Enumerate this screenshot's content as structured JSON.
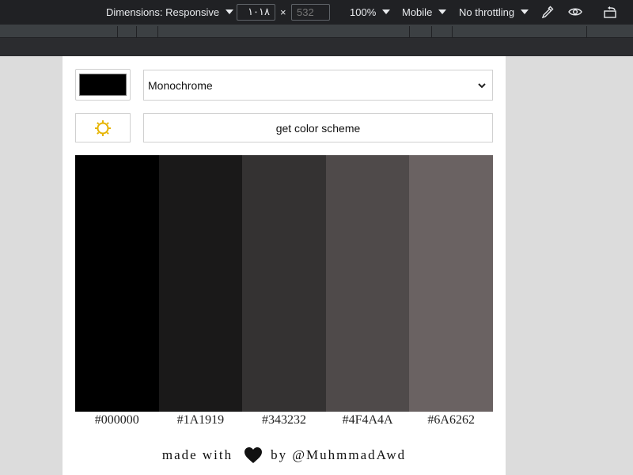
{
  "devtools": {
    "dimensions_label": "Dimensions: Responsive",
    "width_value": "١٠١٨",
    "height_placeholder": "532",
    "times": "×",
    "zoom": "100%",
    "device_type": "Mobile",
    "throttling": "No throttling",
    "icons": [
      "eyedropper-icon",
      "eye-icon",
      "rotate-icon"
    ]
  },
  "app": {
    "seed_color": "#000000",
    "scheme_mode": "Monochrome",
    "theme_icon": "sun-icon",
    "get_button_label": "get color scheme",
    "palette": [
      {
        "hex": "#000000",
        "color": "#000000"
      },
      {
        "hex": "#1A1919",
        "color": "#1A1919"
      },
      {
        "hex": "#343232",
        "color": "#343232"
      },
      {
        "hex": "#4F4A4A",
        "color": "#4F4A4A"
      },
      {
        "hex": "#6A6262",
        "color": "#6A6262"
      }
    ],
    "footer": {
      "made_with": "made with",
      "heart_icon": "heart-icon",
      "by": "by @MuhmmadAwd"
    },
    "colors": {
      "sun_icon": "#e6b400"
    }
  }
}
